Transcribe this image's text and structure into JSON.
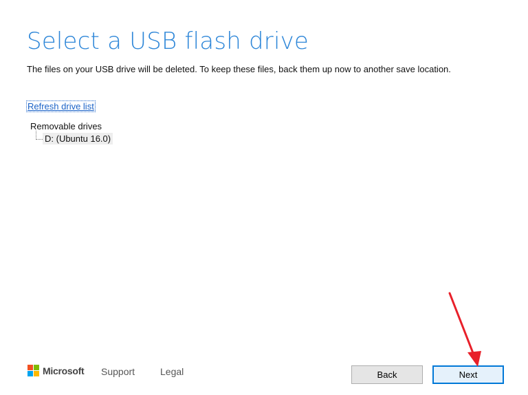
{
  "header": {
    "title": "Select a USB flash drive",
    "subtitle": "The files on your USB drive will be deleted. To keep these files, back them up now to another save location."
  },
  "refresh_link": "Refresh drive list",
  "drive_tree": {
    "root_label": "Removable drives",
    "items": [
      {
        "label": "D: (Ubuntu 16.0)"
      }
    ]
  },
  "footer": {
    "brand": "Microsoft",
    "support": "Support",
    "legal": "Legal"
  },
  "buttons": {
    "back": "Back",
    "next": "Next"
  },
  "colors": {
    "title": "#2d86d8",
    "link": "#1a62c7",
    "next_border": "#0078d7",
    "annotation_arrow": "#e8202a",
    "ms_red": "#f25022",
    "ms_green": "#7fba00",
    "ms_blue": "#00a4ef",
    "ms_yellow": "#ffb900"
  }
}
